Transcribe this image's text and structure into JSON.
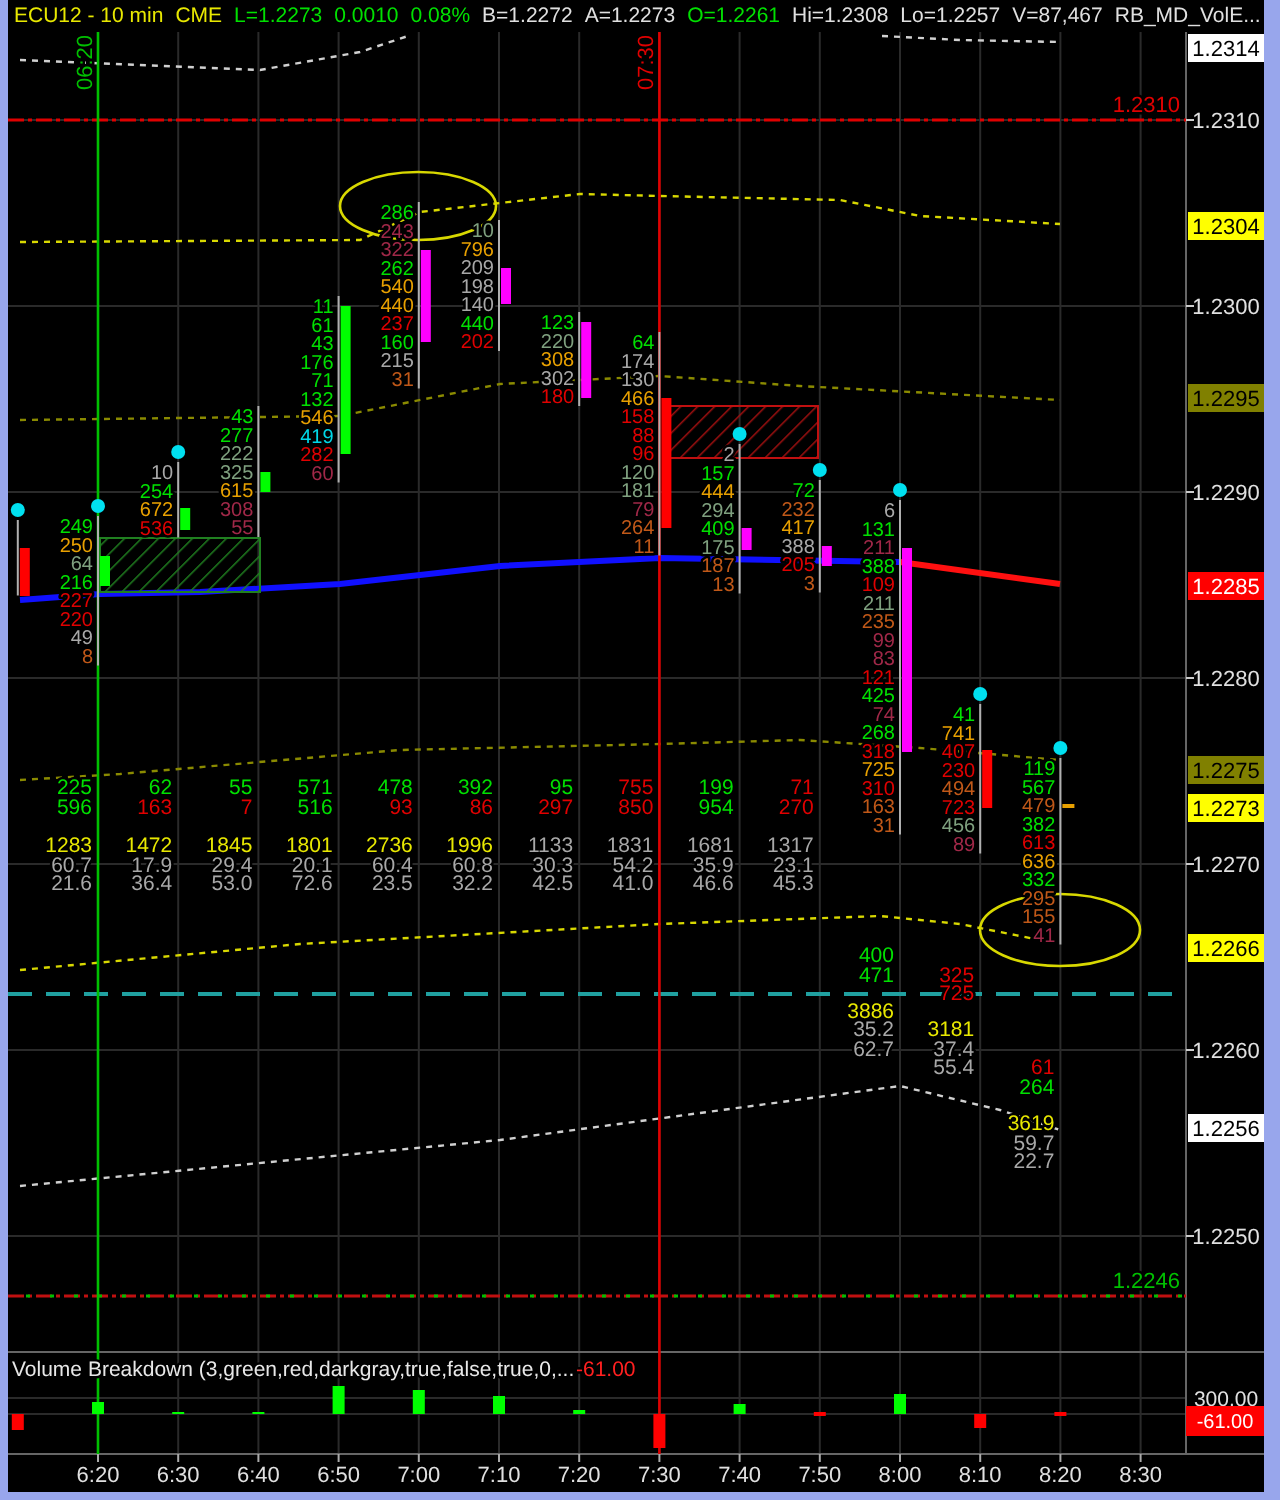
{
  "header": [
    {
      "text": "ECU12 - 10 min",
      "color": "#e8e800"
    },
    {
      "text": "CME",
      "color": "#e8e800"
    },
    {
      "text": "L=1.2273",
      "color": "#00e000"
    },
    {
      "text": "0.0010",
      "color": "#00e000"
    },
    {
      "text": "0.08%",
      "color": "#00e000"
    },
    {
      "text": "B=1.2272",
      "color": "#e0e0e0"
    },
    {
      "text": "A=1.2273",
      "color": "#e0e0e0"
    },
    {
      "text": "O=1.2261",
      "color": "#00e000"
    },
    {
      "text": "Hi=1.2308",
      "color": "#e0e0e0"
    },
    {
      "text": "Lo=1.2257",
      "color": "#e0e0e0"
    },
    {
      "text": "V=87,467",
      "color": "#e0e0e0"
    },
    {
      "text": "RB_MD_VolE...",
      "color": "#e0e0e0"
    }
  ],
  "price_axis": [
    {
      "text": "1.2314",
      "kind": "box",
      "color": "#ffffff"
    },
    {
      "text": "1.2310",
      "kind": "plain"
    },
    {
      "text": "1.2304",
      "kind": "box",
      "color": "#ffff00"
    },
    {
      "text": "1.2300",
      "kind": "plain"
    },
    {
      "text": "1.2295",
      "kind": "box",
      "color": "#808000"
    },
    {
      "text": "1.2290",
      "kind": "plain"
    },
    {
      "text": "1.2285",
      "kind": "box",
      "color": "#ff0000"
    },
    {
      "text": "1.2280",
      "kind": "plain"
    },
    {
      "text": "1.2275",
      "kind": "box",
      "color": "#808000"
    },
    {
      "text": "1.2273",
      "kind": "box",
      "color": "#ffff00"
    },
    {
      "text": "1.2270",
      "kind": "plain"
    },
    {
      "text": "1.2266",
      "kind": "box",
      "color": "#ffff00"
    },
    {
      "text": "1.2260",
      "kind": "plain"
    },
    {
      "text": "1.2256",
      "kind": "box",
      "color": "#ffffff"
    },
    {
      "text": "1.2250",
      "kind": "plain"
    }
  ],
  "price_lines": [
    {
      "label": "1.2310",
      "color": "#e00000"
    },
    {
      "label": "1.2246",
      "color": "#00c000"
    }
  ],
  "time_markers": [
    {
      "label": "06:20",
      "color": "#00c000"
    },
    {
      "label": "07:30",
      "color": "#e00000"
    }
  ],
  "bars": [
    {
      "kind": "down",
      "dot": true
    },
    {
      "kind": "up",
      "dot": true,
      "ladder": [
        {
          "text": "249",
          "color": "#00e000"
        },
        {
          "text": "250",
          "color": "#e8a000"
        },
        {
          "text": "64",
          "color": "#7fa07f"
        },
        {
          "text": "216",
          "color": "#00e000"
        },
        {
          "text": "227",
          "color": "#e00000"
        },
        {
          "text": "220",
          "color": "#e00000"
        },
        {
          "text": "49",
          "color": "#a8a8a8"
        },
        {
          "text": "8",
          "color": "#c05818"
        }
      ],
      "delta": [
        {
          "text": "225",
          "color": "#00e000"
        },
        {
          "text": "596",
          "color": "#00e000"
        }
      ],
      "volume": {
        "text": "1283",
        "color": "#e8e800"
      },
      "stats": [
        "60.7",
        "21.6"
      ]
    },
    {
      "kind": "up",
      "dot": true,
      "ladder": [
        {
          "text": "10",
          "color": "#a8a8a8"
        },
        {
          "text": "254",
          "color": "#00e000"
        },
        {
          "text": "672",
          "color": "#e8a000"
        },
        {
          "text": "536",
          "color": "#e00000"
        }
      ],
      "delta": [
        {
          "text": "62",
          "color": "#00e000"
        },
        {
          "text": "163",
          "color": "#e00000"
        }
      ],
      "volume": {
        "text": "1472",
        "color": "#e8e800"
      },
      "stats": [
        "17.9",
        "36.4"
      ]
    },
    {
      "kind": "up",
      "dot": false,
      "ladder": [
        {
          "text": "43",
          "color": "#00e000"
        },
        {
          "text": "277",
          "color": "#00e000"
        },
        {
          "text": "222",
          "color": "#7fa07f"
        },
        {
          "text": "325",
          "color": "#7fa07f"
        },
        {
          "text": "615",
          "color": "#e8a000"
        },
        {
          "text": "308",
          "color": "#a02848"
        },
        {
          "text": "55",
          "color": "#a02848"
        }
      ],
      "delta": [
        {
          "text": "55",
          "color": "#00e000"
        },
        {
          "text": "7",
          "color": "#e00000"
        }
      ],
      "volume": {
        "text": "1845",
        "color": "#e8e800"
      },
      "stats": [
        "29.4",
        "53.0"
      ]
    },
    {
      "kind": "up",
      "dot": false,
      "ladder": [
        {
          "text": "11",
          "color": "#00e000"
        },
        {
          "text": "61",
          "color": "#00e000"
        },
        {
          "text": "43",
          "color": "#00e000"
        },
        {
          "text": "176",
          "color": "#00e000"
        },
        {
          "text": "71",
          "color": "#00e000"
        },
        {
          "text": "132",
          "color": "#00e000"
        },
        {
          "text": "546",
          "color": "#e8a000"
        },
        {
          "text": "419",
          "color": "#00d8e8"
        },
        {
          "text": "282",
          "color": "#e00000"
        },
        {
          "text": "60",
          "color": "#a02848"
        }
      ],
      "delta": [
        {
          "text": "571",
          "color": "#00e000"
        },
        {
          "text": "516",
          "color": "#00e000"
        }
      ],
      "volume": {
        "text": "1801",
        "color": "#e8e800"
      },
      "stats": [
        "20.1",
        "72.6"
      ]
    },
    {
      "kind": "doji",
      "dot": false,
      "ladder": [
        {
          "text": "286",
          "color": "#00e000"
        },
        {
          "text": "243",
          "color": "#a02848"
        },
        {
          "text": "322",
          "color": "#a02848"
        },
        {
          "text": "262",
          "color": "#00e000"
        },
        {
          "text": "540",
          "color": "#e8a000"
        },
        {
          "text": "440",
          "color": "#e8a000"
        },
        {
          "text": "237",
          "color": "#e00000"
        },
        {
          "text": "160",
          "color": "#00e000"
        },
        {
          "text": "215",
          "color": "#a8a8a8"
        },
        {
          "text": "31",
          "color": "#c05818"
        }
      ],
      "delta": [
        {
          "text": "478",
          "color": "#00e000"
        },
        {
          "text": "93",
          "color": "#e00000"
        }
      ],
      "volume": {
        "text": "2736",
        "color": "#e8e800"
      },
      "stats": [
        "60.4",
        "23.5"
      ]
    },
    {
      "kind": "doji",
      "dot": false,
      "ladder": [
        {
          "text": "10",
          "color": "#7fa07f"
        },
        {
          "text": "796",
          "color": "#e8a000"
        },
        {
          "text": "209",
          "color": "#a8a8a8"
        },
        {
          "text": "198",
          "color": "#a8a8a8"
        },
        {
          "text": "140",
          "color": "#a8a8a8"
        },
        {
          "text": "440",
          "color": "#00e000"
        },
        {
          "text": "202",
          "color": "#e00000"
        }
      ],
      "delta": [
        {
          "text": "392",
          "color": "#00e000"
        },
        {
          "text": "86",
          "color": "#e00000"
        }
      ],
      "volume": {
        "text": "1996",
        "color": "#e8e800"
      },
      "stats": [
        "60.8",
        "32.2"
      ]
    },
    {
      "kind": "doji",
      "dot": false,
      "ladder": [
        {
          "text": "123",
          "color": "#00e000"
        },
        {
          "text": "220",
          "color": "#7fa07f"
        },
        {
          "text": "308",
          "color": "#e8a000"
        },
        {
          "text": "302",
          "color": "#a8a8a8"
        },
        {
          "text": "180",
          "color": "#e00000"
        }
      ],
      "delta": [
        {
          "text": "95",
          "color": "#00e000"
        },
        {
          "text": "297",
          "color": "#e00000"
        }
      ],
      "volume": {
        "text": "1133",
        "color": "#a8a8a8"
      },
      "stats": [
        "30.3",
        "42.5"
      ]
    },
    {
      "kind": "down",
      "dot": false,
      "ladder": [
        {
          "text": "64",
          "color": "#00e000"
        },
        {
          "text": "174",
          "color": "#a8a8a8"
        },
        {
          "text": "130",
          "color": "#a8a8a8"
        },
        {
          "text": "466",
          "color": "#e8a000"
        },
        {
          "text": "158",
          "color": "#e00000"
        },
        {
          "text": "88",
          "color": "#e00000"
        },
        {
          "text": "96",
          "color": "#e00000"
        },
        {
          "text": "120",
          "color": "#7fa07f"
        },
        {
          "text": "181",
          "color": "#7fa07f"
        },
        {
          "text": "79",
          "color": "#a02848"
        },
        {
          "text": "264",
          "color": "#c05818"
        },
        {
          "text": "11",
          "color": "#c05818"
        }
      ],
      "delta": [
        {
          "text": "755",
          "color": "#e00000"
        },
        {
          "text": "850",
          "color": "#e00000"
        }
      ],
      "volume": {
        "text": "1831",
        "color": "#a8a8a8"
      },
      "stats": [
        "54.2",
        "41.0"
      ]
    },
    {
      "kind": "doji",
      "dot": true,
      "ladder": [
        {
          "text": "2",
          "color": "#a8a8a8"
        },
        {
          "text": "157",
          "color": "#00e000"
        },
        {
          "text": "444",
          "color": "#e8a000"
        },
        {
          "text": "294",
          "color": "#7fa07f"
        },
        {
          "text": "409",
          "color": "#00e000"
        },
        {
          "text": "175",
          "color": "#7fa07f"
        },
        {
          "text": "187",
          "color": "#c05818"
        },
        {
          "text": "13",
          "color": "#c05818"
        }
      ],
      "delta": [
        {
          "text": "199",
          "color": "#00e000"
        },
        {
          "text": "954",
          "color": "#00e000"
        }
      ],
      "volume": {
        "text": "1681",
        "color": "#a8a8a8"
      },
      "stats": [
        "35.9",
        "46.6"
      ]
    },
    {
      "kind": "doji",
      "dot": true,
      "ladder": [
        {
          "text": "72",
          "color": "#00e000"
        },
        {
          "text": "232",
          "color": "#c05818"
        },
        {
          "text": "417",
          "color": "#e8a000"
        },
        {
          "text": "388",
          "color": "#a8a8a8"
        },
        {
          "text": "205",
          "color": "#e00000"
        },
        {
          "text": "3",
          "color": "#c05818"
        }
      ],
      "delta": [
        {
          "text": "71",
          "color": "#e00000"
        },
        {
          "text": "270",
          "color": "#e00000"
        }
      ],
      "volume": {
        "text": "1317",
        "color": "#a8a8a8"
      },
      "stats": [
        "23.1",
        "45.3"
      ]
    },
    {
      "kind": "doji",
      "dot": true,
      "ladder": [
        {
          "text": "6",
          "color": "#a8a8a8"
        },
        {
          "text": "131",
          "color": "#00e000"
        },
        {
          "text": "211",
          "color": "#a02848"
        },
        {
          "text": "388",
          "color": "#00e000"
        },
        {
          "text": "109",
          "color": "#e00000"
        },
        {
          "text": "211",
          "color": "#7fa07f"
        },
        {
          "text": "235",
          "color": "#c05818"
        },
        {
          "text": "99",
          "color": "#a02848"
        },
        {
          "text": "83",
          "color": "#a02848"
        },
        {
          "text": "121",
          "color": "#e00000"
        },
        {
          "text": "425",
          "color": "#00e000"
        },
        {
          "text": "74",
          "color": "#a02848"
        },
        {
          "text": "268",
          "color": "#00e000"
        },
        {
          "text": "318",
          "color": "#e00000"
        },
        {
          "text": "725",
          "color": "#e8a000"
        },
        {
          "text": "310",
          "color": "#e00000"
        },
        {
          "text": "163",
          "color": "#c05818"
        },
        {
          "text": "31",
          "color": "#c05818"
        }
      ],
      "delta": [
        {
          "text": "400",
          "color": "#00e000"
        },
        {
          "text": "471",
          "color": "#00e000"
        }
      ],
      "volume": {
        "text": "3886",
        "color": "#e8e800"
      },
      "stats": [
        "35.2",
        "62.7"
      ]
    },
    {
      "kind": "down",
      "dot": true,
      "ladder": [
        {
          "text": "41",
          "color": "#00e000"
        },
        {
          "text": "741",
          "color": "#e8a000"
        },
        {
          "text": "407",
          "color": "#e00000"
        },
        {
          "text": "230",
          "color": "#e00000"
        },
        {
          "text": "494",
          "color": "#c05818"
        },
        {
          "text": "723",
          "color": "#e00000"
        },
        {
          "text": "456",
          "color": "#7fa07f"
        },
        {
          "text": "89",
          "color": "#a02848"
        }
      ],
      "delta": [
        {
          "text": "325",
          "color": "#e00000"
        },
        {
          "text": "725",
          "color": "#e00000"
        }
      ],
      "volume": {
        "text": "3181",
        "color": "#e8e800"
      },
      "stats": [
        "37.4",
        "55.4"
      ]
    },
    {
      "kind": "flat",
      "dot": true,
      "ladder": [
        {
          "text": "119",
          "color": "#00e000"
        },
        {
          "text": "567",
          "color": "#00e000"
        },
        {
          "text": "479",
          "color": "#c05818"
        },
        {
          "text": "382",
          "color": "#00e000"
        },
        {
          "text": "613",
          "color": "#e00000"
        },
        {
          "text": "636",
          "color": "#e8a000"
        },
        {
          "text": "332",
          "color": "#00e000"
        },
        {
          "text": "295",
          "color": "#c05818"
        },
        {
          "text": "155",
          "color": "#c05818"
        },
        {
          "text": "41",
          "color": "#a02848"
        }
      ],
      "delta": [
        {
          "text": "61",
          "color": "#e00000"
        },
        {
          "text": "264",
          "color": "#00e000"
        }
      ],
      "volume": {
        "text": "3619",
        "color": "#e8e800"
      },
      "stats": [
        "59.7",
        "22.7"
      ]
    }
  ],
  "volume_panel": {
    "title": "Volume Breakdown (3,green,red,darkgray,true,false,true,0,...",
    "value": "-61.00",
    "axis_label": "300.00",
    "marker": "-61.00"
  },
  "time_axis": [
    "6:20",
    "6:30",
    "6:40",
    "6:50",
    "7:00",
    "7:10",
    "7:20",
    "7:30",
    "7:40",
    "7:50",
    "8:00",
    "8:10",
    "8:20",
    "8:30"
  ]
}
